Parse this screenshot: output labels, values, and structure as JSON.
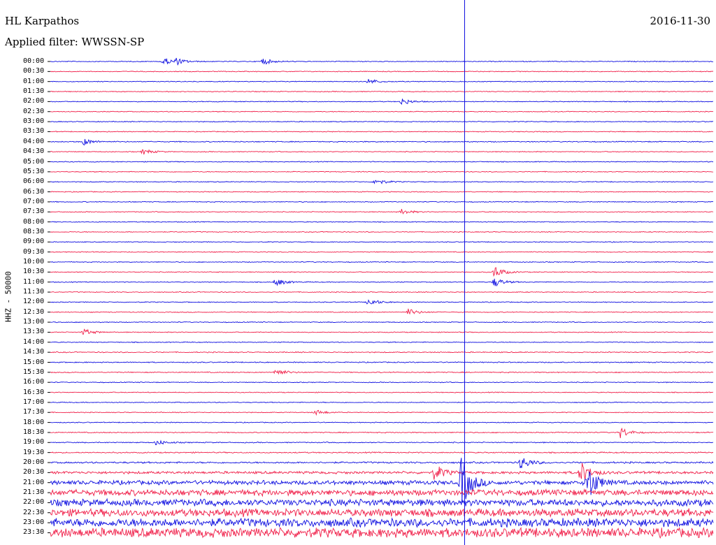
{
  "header": {
    "station": "HL Karpathos",
    "filter": "Applied filter: WWSSN-SP",
    "date": "2016-11-30"
  },
  "yaxis": {
    "label": "HHZ - 50000"
  },
  "colors": {
    "trace_a": "#1010e0",
    "trace_b": "#f0204a",
    "marker": "#1010e0"
  },
  "chart_data": {
    "type": "line",
    "title": "HL Karpathos",
    "subtitle": "Applied filter: WWSSN-SP",
    "ylabel": "HHZ - 50000",
    "xlabel": "",
    "grid": false,
    "rows": [
      "00:00",
      "00:30",
      "01:00",
      "01:30",
      "02:00",
      "02:30",
      "03:00",
      "03:30",
      "04:00",
      "04:30",
      "05:00",
      "05:30",
      "06:00",
      "06:30",
      "07:00",
      "07:30",
      "08:00",
      "08:30",
      "09:00",
      "09:30",
      "10:00",
      "10:30",
      "11:00",
      "11:30",
      "12:00",
      "12:30",
      "13:00",
      "13:30",
      "14:00",
      "14:30",
      "15:00",
      "15:30",
      "16:00",
      "16:30",
      "17:00",
      "17:30",
      "18:00",
      "18:30",
      "19:00",
      "19:30",
      "20:00",
      "20:30",
      "21:00",
      "21:30",
      "22:00",
      "22:30",
      "23:00",
      "23:30"
    ],
    "row_colors": "alternating blue / red",
    "marker_x_fraction": 0.625,
    "noise_levels": [
      0.5,
      0.5,
      0.5,
      0.5,
      0.5,
      0.5,
      0.5,
      0.5,
      0.6,
      0.5,
      0.5,
      0.5,
      0.5,
      0.5,
      0.5,
      0.5,
      0.5,
      0.5,
      0.5,
      0.5,
      0.5,
      0.5,
      0.5,
      0.5,
      0.5,
      0.5,
      0.5,
      0.5,
      0.5,
      0.6,
      0.6,
      0.6,
      0.5,
      0.5,
      0.5,
      0.5,
      0.5,
      0.6,
      0.6,
      0.7,
      1.0,
      1.5,
      2.5,
      3.5,
      4.0,
      4.5,
      5.0,
      5.5
    ],
    "events": [
      {
        "row": 0,
        "x": 0.17,
        "amp": 6
      },
      {
        "row": 0,
        "x": 0.19,
        "amp": 4
      },
      {
        "row": 0,
        "x": 0.32,
        "amp": 5
      },
      {
        "row": 2,
        "x": 0.48,
        "amp": 4
      },
      {
        "row": 4,
        "x": 0.53,
        "amp": 5
      },
      {
        "row": 8,
        "x": 0.05,
        "amp": 5
      },
      {
        "row": 9,
        "x": 0.14,
        "amp": 4
      },
      {
        "row": 12,
        "x": 0.49,
        "amp": 5
      },
      {
        "row": 15,
        "x": 0.53,
        "amp": 4
      },
      {
        "row": 21,
        "x": 0.67,
        "amp": 9
      },
      {
        "row": 22,
        "x": 0.34,
        "amp": 6
      },
      {
        "row": 22,
        "x": 0.67,
        "amp": 7
      },
      {
        "row": 24,
        "x": 0.48,
        "amp": 6
      },
      {
        "row": 25,
        "x": 0.54,
        "amp": 5
      },
      {
        "row": 27,
        "x": 0.05,
        "amp": 5
      },
      {
        "row": 31,
        "x": 0.34,
        "amp": 6
      },
      {
        "row": 35,
        "x": 0.4,
        "amp": 4
      },
      {
        "row": 37,
        "x": 0.86,
        "amp": 8
      },
      {
        "row": 38,
        "x": 0.16,
        "amp": 4
      },
      {
        "row": 40,
        "x": 0.71,
        "amp": 10
      },
      {
        "row": 41,
        "x": 0.58,
        "amp": 12
      },
      {
        "row": 41,
        "x": 0.8,
        "amp": 16
      },
      {
        "row": 42,
        "x": 0.62,
        "amp": 40
      },
      {
        "row": 42,
        "x": 0.81,
        "amp": 28
      }
    ]
  }
}
